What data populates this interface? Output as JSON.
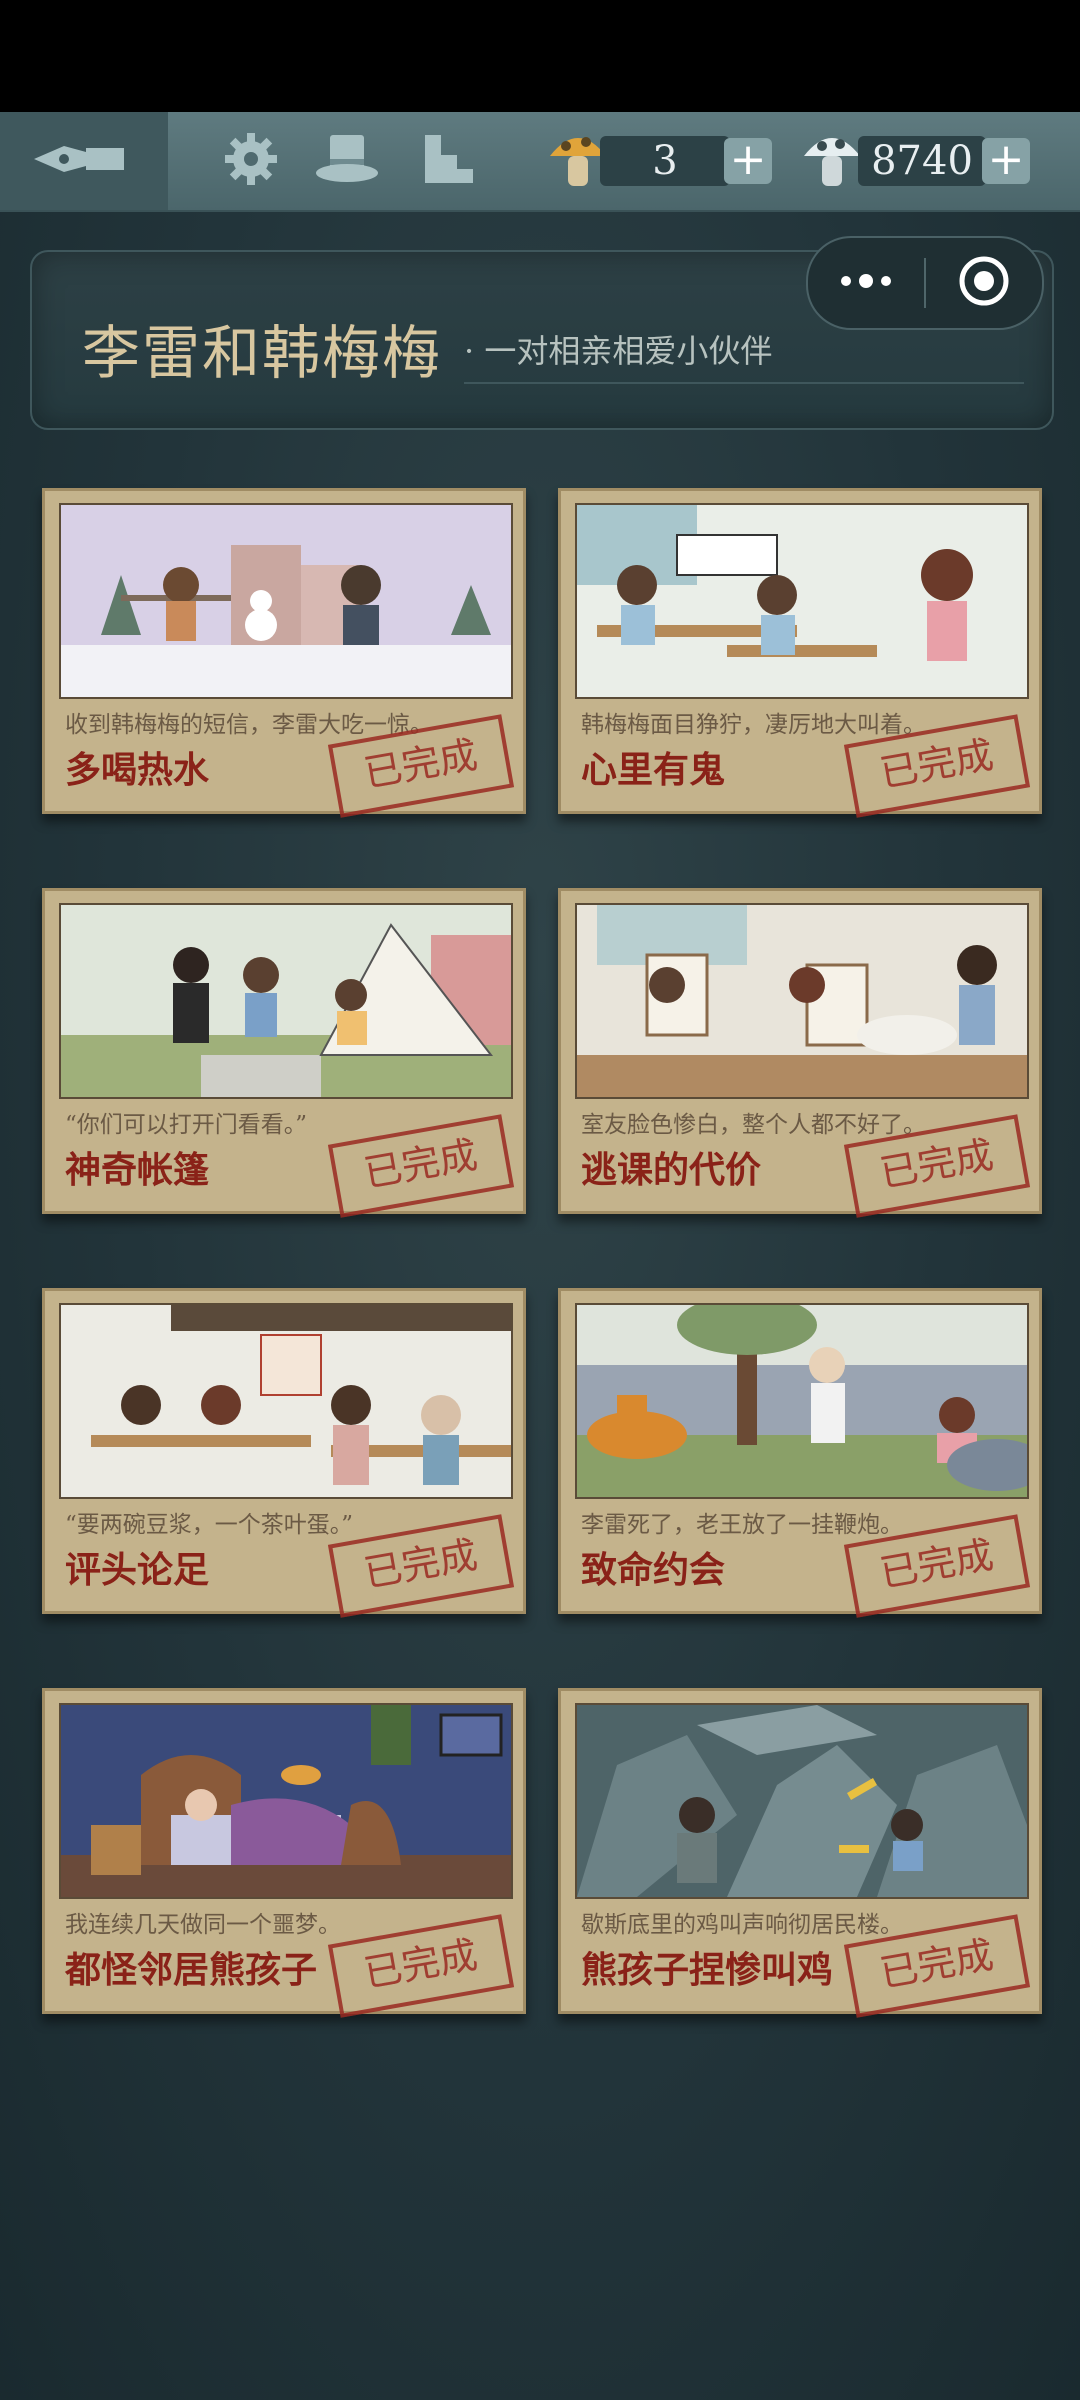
{
  "topbar": {
    "mushroom_count": "3",
    "coin_count": "8740",
    "plus_label": "+"
  },
  "header": {
    "title": "李雷和韩梅梅",
    "subtitle": "· 一对相亲相爱小伙伴"
  },
  "levels": [
    {
      "desc": "收到韩梅梅的短信，李雷大吃一惊。",
      "name": "多喝热水",
      "status": "已完成",
      "scene": "snow"
    },
    {
      "desc": "韩梅梅面目狰狞，凄厉地大叫着。",
      "name": "心里有鬼",
      "status": "已完成",
      "scene": "classroom"
    },
    {
      "desc": "“你们可以打开门看看。”",
      "name": "神奇帐篷",
      "status": "已完成",
      "scene": "tent"
    },
    {
      "desc": "室友脸色惨白，整个人都不好了。",
      "name": "逃课的代价",
      "status": "已完成",
      "scene": "artroom"
    },
    {
      "desc": "“要两碗豆浆，一个茶叶蛋。”",
      "name": "评头论足",
      "status": "已完成",
      "scene": "canteen"
    },
    {
      "desc": "李雷死了，老王放了一挂鞭炮。",
      "name": "致命约会",
      "status": "已完成",
      "scene": "tiger"
    },
    {
      "desc": "我连续几天做同一个噩梦。",
      "name": "都怪邻居熊孩子",
      "status": "已完成",
      "scene": "bedroom"
    },
    {
      "desc": "歇斯底里的鸡叫声响彻居民楼。",
      "name": "熊孩子捏惨叫鸡",
      "status": "已完成",
      "scene": "rubble"
    }
  ]
}
